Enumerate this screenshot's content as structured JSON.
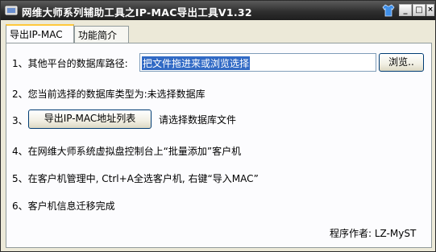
{
  "window": {
    "title": "网维大师系列辅助工具之IP-MAC导出工具V1.32"
  },
  "titlebar_buttons": {
    "minimize": "_",
    "maximize": "□",
    "close": "×"
  },
  "tabs": [
    {
      "label": "导出IP-MAC",
      "active": true
    },
    {
      "label": "功能简介",
      "active": false
    }
  ],
  "steps": {
    "step1_label": "1、其他平台的数据库路径:",
    "path_value": "把文件拖进来或浏览选择",
    "browse_label": "浏览..",
    "step2_text": "2、您当前选择的数据库类型为:未选择数据库",
    "step3_prefix": "3、",
    "export_button": "导出IP-MAC地址列表",
    "status_text": "请选择数据库文件",
    "step4_text": "4、在网维大师系统虚拟盘控制台上“批量添加”客户机",
    "step5_text": "5、在客户机管理中, Ctrl+A全选客户机, 右键“导入MAC”",
    "step6_text": "6、客户机信息迁移完成"
  },
  "footer": {
    "author": "程序作者: LZ-MyST"
  },
  "colors": {
    "accent_tab": "#ffc83c",
    "selection": "#316ac5",
    "titlebar": "#2f2f2f"
  },
  "icons": {
    "app": "app-icon",
    "skin": "shirt-icon"
  }
}
